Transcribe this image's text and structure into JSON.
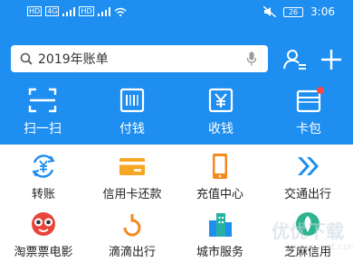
{
  "status_bar": {
    "network_badge_1": "HD",
    "network_badge_2": "4G",
    "network_badge_3": "HD",
    "battery": "26",
    "time": "3:06"
  },
  "header": {
    "search": {
      "value": "2019年账单",
      "icon": "search-icon",
      "voice_icon": "mic-icon"
    },
    "contacts_icon": "contacts-icon",
    "add_icon": "plus-icon"
  },
  "quick_actions": [
    {
      "label": "扫一扫",
      "icon": "scan-icon"
    },
    {
      "label": "付钱",
      "icon": "barcode-pay-icon"
    },
    {
      "label": "收钱",
      "icon": "receive-money-icon"
    },
    {
      "label": "卡包",
      "icon": "card-wallet-icon"
    }
  ],
  "services": [
    {
      "label": "转账",
      "icon": "transfer-icon",
      "color": "#1e8ef0"
    },
    {
      "label": "信用卡还款",
      "icon": "credit-card-icon",
      "color": "#f5a623"
    },
    {
      "label": "充值中心",
      "icon": "phone-topup-icon",
      "color": "#f5891f"
    },
    {
      "label": "交通出行",
      "icon": "transport-icon",
      "color": "#1e8ef0"
    },
    {
      "label": "淘票票电影",
      "icon": "movie-ticket-icon",
      "color": "#e8453c"
    },
    {
      "label": "滴滴出行",
      "icon": "didi-icon",
      "color": "#f5891f"
    },
    {
      "label": "城市服务",
      "icon": "city-service-icon",
      "color": "#1e8ef0"
    },
    {
      "label": "芝麻信用",
      "icon": "sesame-credit-icon",
      "color": "#2db38f"
    }
  ],
  "colors": {
    "primary": "#1e8ef0",
    "background": "#ffffff",
    "alert": "#ff4a3d"
  },
  "watermark": {
    "line1": "优优下载",
    "line2": "www.yyxt.com"
  }
}
